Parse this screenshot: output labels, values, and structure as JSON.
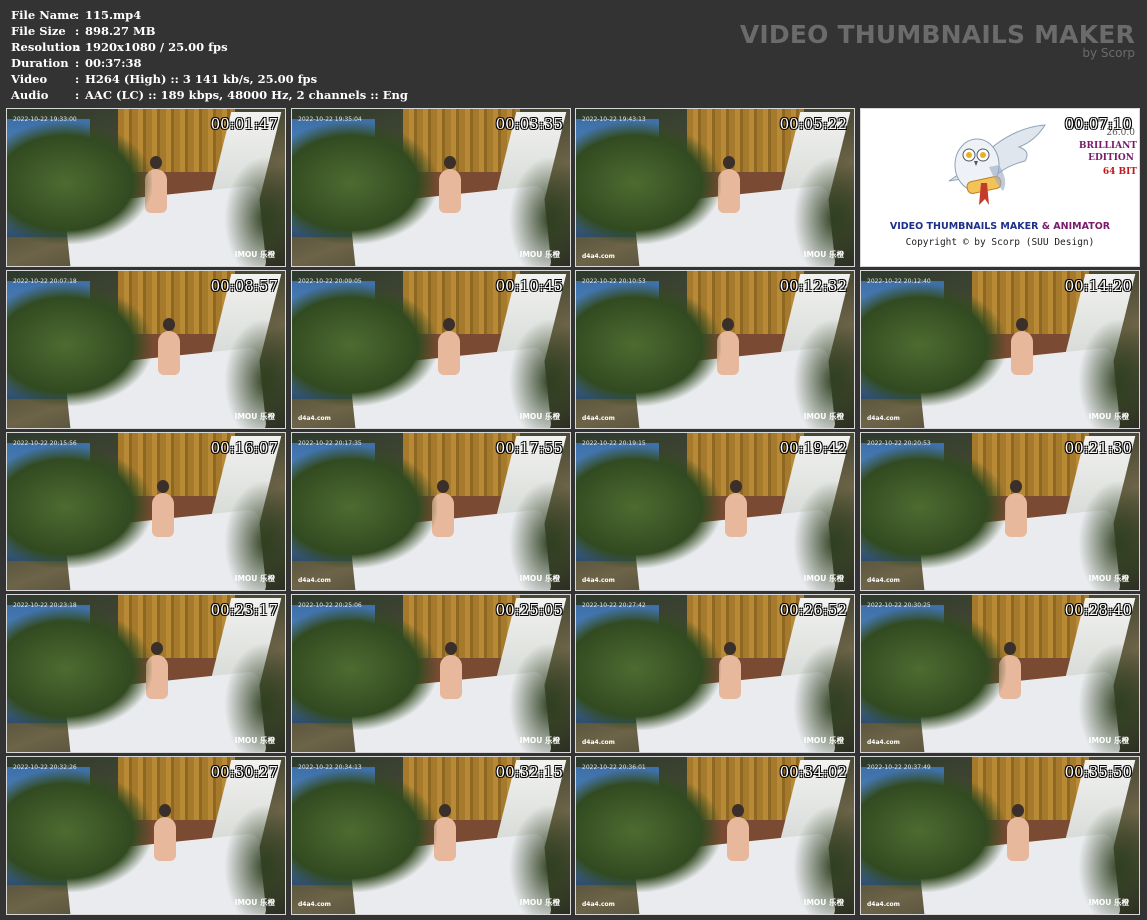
{
  "file_info": [
    {
      "key": "File Name",
      "value": "115.mp4"
    },
    {
      "key": "File Size",
      "value": "898.27 MB"
    },
    {
      "key": "Resolution",
      "value": "1920x1080 / 25.00 fps"
    },
    {
      "key": "Duration",
      "value": "00:37:38"
    },
    {
      "key": "Video",
      "value": "H264 (High) :: 3 141 kb/s, 25.00 fps"
    },
    {
      "key": "Audio",
      "value": "AAC (LC) :: 189 kbps, 48000 Hz, 2 channels :: Eng"
    }
  ],
  "separator": ":",
  "brand": {
    "title": "VIDEO THUMBNAILS MAKER",
    "subtitle": "by Scorp"
  },
  "watermarks": {
    "imou": "IMOU 乐橙",
    "site": "d4a4.com"
  },
  "promo": {
    "timecode": "00:07:10",
    "version": "26.0.0",
    "edition_1": "BRILLIANT",
    "edition_2": "EDITION",
    "edition_3": "64 BIT",
    "line_a": "VIDEO THUMBNAILS MAKER ",
    "line_amp": "& ANIMATOR",
    "copyright": "Copyright © by Scorp (SUU Design)"
  },
  "thumbnails": [
    {
      "timecode": "00:01:47",
      "stamp": "2022-10-22 19:33:00",
      "site": false
    },
    {
      "timecode": "00:03:35",
      "stamp": "2022-10-22 19:35:04",
      "site": false
    },
    {
      "timecode": "00:05:22",
      "stamp": "2022-10-22 19:43:13",
      "site": true
    },
    {
      "timecode": "00:08:57",
      "stamp": "2022-10-22 20:07:18",
      "site": false
    },
    {
      "timecode": "00:10:45",
      "stamp": "2022-10-22 20:09:05",
      "site": true
    },
    {
      "timecode": "00:12:32",
      "stamp": "2022-10-22 20:10:53",
      "site": true
    },
    {
      "timecode": "00:14:20",
      "stamp": "2022-10-22 20:12:40",
      "site": true
    },
    {
      "timecode": "00:16:07",
      "stamp": "2022-10-22 20:15:56",
      "site": false
    },
    {
      "timecode": "00:17:55",
      "stamp": "2022-10-22 20:17:35",
      "site": true
    },
    {
      "timecode": "00:19:42",
      "stamp": "2022-10-22 20:19:15",
      "site": true
    },
    {
      "timecode": "00:21:30",
      "stamp": "2022-10-22 20:20:53",
      "site": true
    },
    {
      "timecode": "00:23:17",
      "stamp": "2022-10-22 20:23:18",
      "site": false
    },
    {
      "timecode": "00:25:05",
      "stamp": "2022-10-22 20:25:06",
      "site": false
    },
    {
      "timecode": "00:26:52",
      "stamp": "2022-10-22 20:27:42",
      "site": true
    },
    {
      "timecode": "00:28:40",
      "stamp": "2022-10-22 20:30:25",
      "site": true
    },
    {
      "timecode": "00:30:27",
      "stamp": "2022-10-22 20:32:26",
      "site": false
    },
    {
      "timecode": "00:32:15",
      "stamp": "2022-10-22 20:34:13",
      "site": true
    },
    {
      "timecode": "00:34:02",
      "stamp": "2022-10-22 20:36:01",
      "site": true
    },
    {
      "timecode": "00:35:50",
      "stamp": "2022-10-22 20:37:49",
      "site": true
    }
  ]
}
